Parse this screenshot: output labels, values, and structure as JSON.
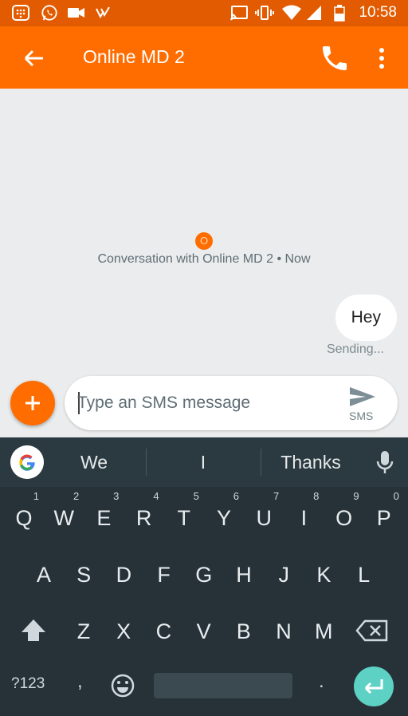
{
  "status_bar": {
    "time": "10:58"
  },
  "app_bar": {
    "title": "Online MD 2"
  },
  "conversation": {
    "avatar_letter": "O",
    "info": "Conversation with Online MD 2 • Now",
    "messages": [
      {
        "text": "Hey",
        "status": "Sending..."
      }
    ]
  },
  "compose": {
    "placeholder": "Type an SMS message",
    "send_label": "SMS"
  },
  "keyboard": {
    "suggestions": [
      "We",
      "I",
      "Thanks"
    ],
    "row1": [
      {
        "key": "Q",
        "hint": "1"
      },
      {
        "key": "W",
        "hint": "2"
      },
      {
        "key": "E",
        "hint": "3"
      },
      {
        "key": "R",
        "hint": "4"
      },
      {
        "key": "T",
        "hint": "5"
      },
      {
        "key": "Y",
        "hint": "6"
      },
      {
        "key": "U",
        "hint": "7"
      },
      {
        "key": "I",
        "hint": "8"
      },
      {
        "key": "O",
        "hint": "9"
      },
      {
        "key": "P",
        "hint": "0"
      }
    ],
    "row2": [
      "A",
      "S",
      "D",
      "F",
      "G",
      "H",
      "J",
      "K",
      "L"
    ],
    "row3": [
      "Z",
      "X",
      "C",
      "V",
      "B",
      "N",
      "M"
    ],
    "symbols_label": "?123",
    "comma": ",",
    "period": "."
  },
  "colors": {
    "accent": "#ff6d00",
    "status_bar": "#e35b00",
    "keyboard_bg": "#263238",
    "enter_key": "#5ed1c5"
  }
}
